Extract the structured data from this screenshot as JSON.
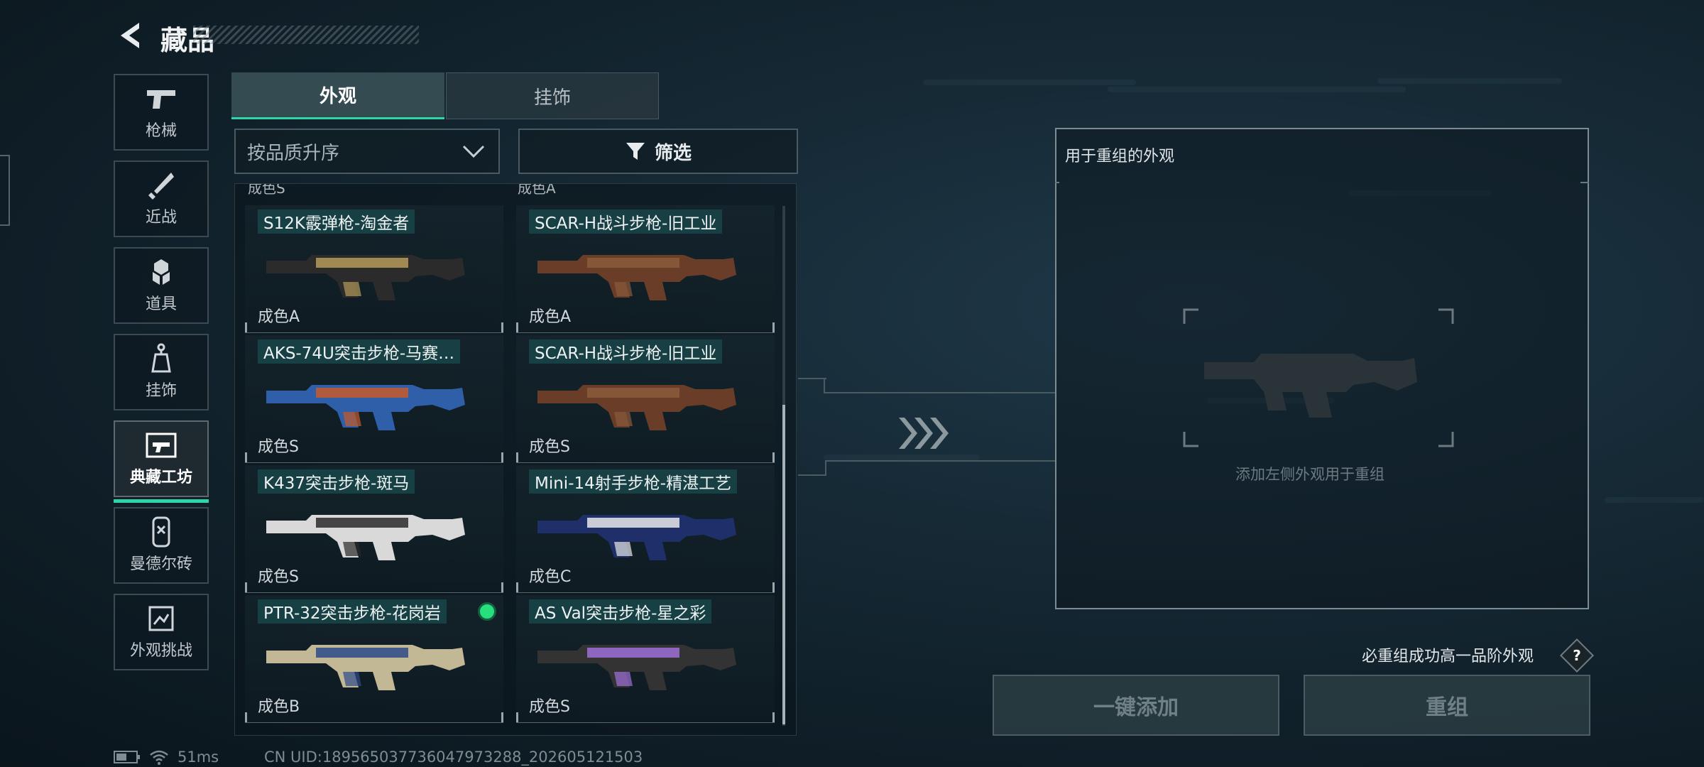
{
  "header": {
    "title": "藏品"
  },
  "sidebar": {
    "items": [
      {
        "label": "枪械",
        "icon": "pistol-icon"
      },
      {
        "label": "近战",
        "icon": "knife-icon"
      },
      {
        "label": "道具",
        "icon": "grenade-icon"
      },
      {
        "label": "挂饰",
        "icon": "charm-icon"
      },
      {
        "label": "典藏工坊",
        "icon": "workshop-icon",
        "active": true
      },
      {
        "label": "曼德尔砖",
        "icon": "brick-icon"
      },
      {
        "label": "外观挑战",
        "icon": "challenge-icon"
      }
    ]
  },
  "tabs": {
    "appearance": "外观",
    "charm": "挂饰"
  },
  "sort": {
    "value": "按品质升序"
  },
  "filter": {
    "label": "筛选"
  },
  "partial_row": {
    "left": "成色S",
    "right": "成色A"
  },
  "skins": [
    {
      "name": "S12K霰弹枪-淘金者",
      "grade": "成色A",
      "colors": [
        "#2b2b2b",
        "#b59a5a"
      ]
    },
    {
      "name": "SCAR-H战斗步枪-旧工业",
      "grade": "成色A",
      "colors": [
        "#6a3d28",
        "#8a5a3a"
      ]
    },
    {
      "name": "AKS-74U突击步枪-马赛…",
      "grade": "成色S",
      "colors": [
        "#2f5fa8",
        "#c75a2a"
      ]
    },
    {
      "name": "SCAR-H战斗步枪-旧工业",
      "grade": "成色S",
      "colors": [
        "#6a3d28",
        "#8a5a3a"
      ]
    },
    {
      "name": "K437突击步枪-斑马",
      "grade": "成色S",
      "colors": [
        "#d9d9d9",
        "#2a2a2a"
      ]
    },
    {
      "name": "Mini-14射手步枪-精湛工艺",
      "grade": "成色C",
      "colors": [
        "#1e2f6a",
        "#e8e8e8"
      ]
    },
    {
      "name": "PTR-32突击步枪-花岗岩",
      "grade": "成色B",
      "colors": [
        "#c2b896",
        "#2d4a8a"
      ],
      "selected": true
    },
    {
      "name": "AS Val突击步枪-星之彩",
      "grade": "成色S",
      "colors": [
        "#333333",
        "#a070d8"
      ]
    }
  ],
  "recombine_panel": {
    "title": "用于重组的外观",
    "empty_hint": "添加左侧外观用于重组"
  },
  "recombine_note": "必重组成功高一品阶外观",
  "help_label": "?",
  "buttons": {
    "add_all": "一键添加",
    "recombine": "重组"
  },
  "status": {
    "ping": "51ms",
    "uid": "CN UID:189565037736047973288_202605121503"
  },
  "colors": {
    "accent": "#2fd5a6",
    "selected_dot": "#26e07e"
  }
}
